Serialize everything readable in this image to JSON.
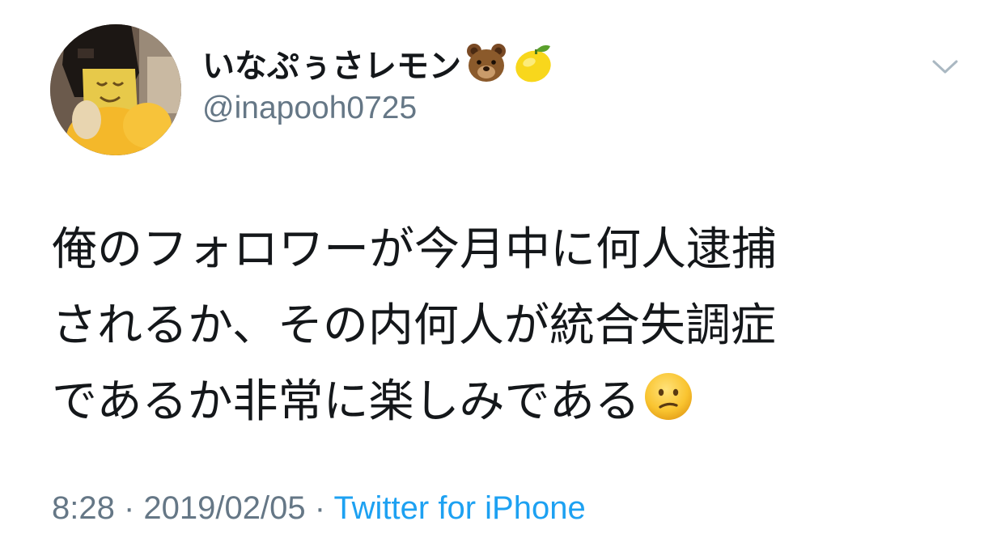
{
  "user": {
    "display_name": "いなぷぅさレモン",
    "name_emojis": [
      "bear-face-emoji",
      "lemon-emoji"
    ],
    "handle": "@inapooh0725",
    "avatar": "profile-photo"
  },
  "menu": {
    "icon": "chevron-down-icon"
  },
  "tweet": {
    "lines": [
      "俺のフォロワーが今月中に何人逮捕",
      "されるか、その内何人が統合失調症",
      "であるか非常に楽しみである"
    ],
    "trailing_emoji": "confused-face-emoji"
  },
  "meta": {
    "time": "8:28",
    "sep1": " · ",
    "date": "2019/02/05",
    "sep2": " · ",
    "source": "Twitter for iPhone"
  },
  "colors": {
    "text": "#14171a",
    "secondary": "#657786",
    "link": "#1da1f2"
  }
}
